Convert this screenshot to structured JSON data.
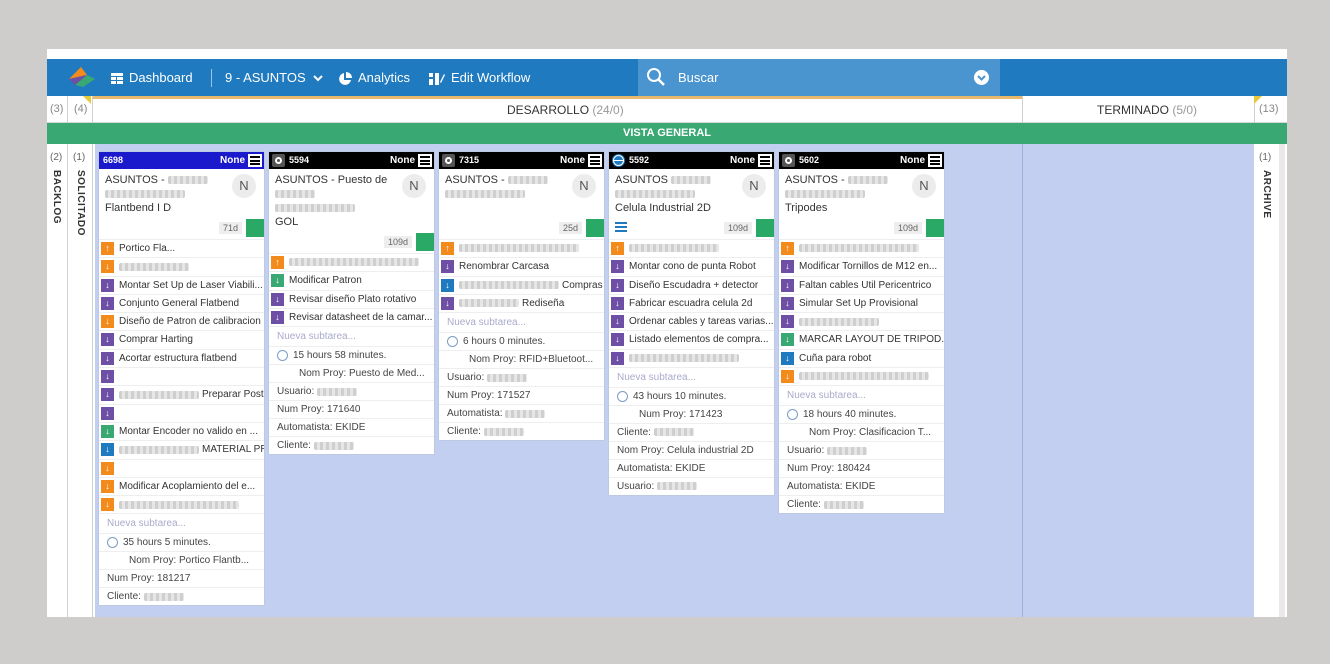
{
  "topbar": {
    "dashboard": "Dashboard",
    "board_select": "9 - ASUNTOS",
    "analytics": "Analytics",
    "edit_workflow": "Edit Workflow",
    "search_label": "Buscar"
  },
  "header": {
    "left_count_1": "(3)",
    "left_count_2": "(4)",
    "desarrollo_title": "DESARROLLO",
    "desarrollo_count": "(24/0)",
    "terminado_title": "TERMINADO",
    "terminado_count": "(5/0)",
    "right_count": "(13)"
  },
  "vista_general": "VISTA GENERAL",
  "side": {
    "backlog_count": "(2)",
    "backlog": "BACKLOG",
    "solicitado_count": "(1)",
    "solicitado": "SOLICITADO",
    "archive_count": "(1)",
    "archive": "ARCHIVE"
  },
  "colors": {
    "topbar": "#1f7abf",
    "search": "#4a94d0",
    "vista": "#3aa873",
    "lane": "#c2cff0",
    "orange": "#f28a1c",
    "purple": "#6e4fa6",
    "green": "#3aa873",
    "blue": "#1f7abf"
  },
  "cards": [
    {
      "id": "6698",
      "none": "None",
      "avatar": "N",
      "title_1": "ASUNTOS -",
      "title_2": "Flantbend I D",
      "age": "71d",
      "subtasks": [
        {
          "c": "o",
          "t": "Portico Fla..."
        },
        {
          "c": "o",
          "t": ""
        },
        {
          "c": "p",
          "t": "Montar Set Up de Laser Viabili..."
        },
        {
          "c": "p",
          "t": "Conjunto General Flatbend"
        },
        {
          "c": "o",
          "t": "Diseño de Patron de calibracion"
        },
        {
          "c": "p",
          "t": "Comprar Harting"
        },
        {
          "c": "p",
          "t": "Acortar estructura flatbend"
        },
        {
          "c": "p",
          "t": ""
        },
        {
          "c": "p",
          "t": "Preparar Poste"
        },
        {
          "c": "p",
          "t": ""
        },
        {
          "c": "g",
          "t": "Montar Encoder no valido en ..."
        },
        {
          "c": "bl",
          "t": "MATERIAL PRESTAMO"
        },
        {
          "c": "o",
          "t": ""
        },
        {
          "c": "o",
          "t": "Modificar Acoplamiento del e..."
        },
        {
          "c": "o",
          "t": ""
        }
      ],
      "nueva": "Nueva subtarea...",
      "hours": "35 hours 5 minutes.",
      "nom_proy": "Nom Proy: Portico Flantb...",
      "extra": [
        "Num Proy: 181217",
        "Cliente:"
      ]
    },
    {
      "id": "5594",
      "none": "None",
      "avatar": "N",
      "title_1": "ASUNTOS - Puesto de",
      "title_2": "GOL",
      "age": "109d",
      "subtasks": [
        {
          "c": "o",
          "t": ""
        },
        {
          "c": "g",
          "t": "Modificar Patron"
        },
        {
          "c": "p",
          "t": "Revisar diseño Plato rotativo"
        },
        {
          "c": "p",
          "t": "Revisar datasheet de la camar..."
        }
      ],
      "nueva": "Nueva subtarea...",
      "hours": "15 hours 58 minutes.",
      "nom_proy": "Nom Proy: Puesto de Med...",
      "extra": [
        "Usuario:",
        "Num Proy: 171640",
        "Automatista: EKIDE",
        "Cliente:"
      ]
    },
    {
      "id": "7315",
      "none": "None",
      "avatar": "N",
      "title_1": "ASUNTOS -",
      "title_2": "",
      "age": "25d",
      "subtasks": [
        {
          "c": "o",
          "t": ""
        },
        {
          "c": "p",
          "t": "Renombrar Carcasa"
        },
        {
          "c": "bl",
          "t": "Compras carcasa"
        },
        {
          "c": "p",
          "t": "Rediseña"
        }
      ],
      "nueva": "Nueva subtarea...",
      "hours": "6 hours 0 minutes.",
      "nom_proy": "Nom Proy: RFID+Bluetoot...",
      "extra": [
        "Usuario:",
        "Num Proy: 171527",
        "Automatista:",
        "Cliente:"
      ]
    },
    {
      "id": "5592",
      "none": "None",
      "avatar": "N",
      "title_1": "ASUNTOS",
      "title_2": "Celula Industrial 2D",
      "age": "109d",
      "subtasks": [
        {
          "c": "o",
          "t": ""
        },
        {
          "c": "p",
          "t": "Montar cono de punta Robot"
        },
        {
          "c": "p",
          "t": "Diseño Escudadra + detector"
        },
        {
          "c": "p",
          "t": "Fabricar escuadra celula 2d"
        },
        {
          "c": "p",
          "t": "Ordenar cables y tareas varias..."
        },
        {
          "c": "p",
          "t": "Listado elementos de compra..."
        },
        {
          "c": "p",
          "t": ""
        }
      ],
      "nueva": "Nueva subtarea...",
      "hours": "43 hours 10 minutes.",
      "nom_proy": "Num Proy: 171423",
      "extra": [
        "Cliente:",
        "Nom Proy: Celula industrial 2D",
        "Automatista: EKIDE",
        "Usuario:"
      ]
    },
    {
      "id": "5602",
      "none": "None",
      "avatar": "N",
      "title_1": "ASUNTOS -",
      "title_2": "Tripodes",
      "age": "109d",
      "subtasks": [
        {
          "c": "o",
          "t": ""
        },
        {
          "c": "p",
          "t": "Modificar Tornillos de M12 en..."
        },
        {
          "c": "p",
          "t": "Faltan cables Util Pericentrico"
        },
        {
          "c": "p",
          "t": "Simular Set Up Provisional"
        },
        {
          "c": "p",
          "t": ""
        },
        {
          "c": "g",
          "t": "MARCAR LAYOUT DE TRIPOD..."
        },
        {
          "c": "bl",
          "t": "Cuña para robot"
        },
        {
          "c": "o",
          "t": ""
        }
      ],
      "nueva": "Nueva subtarea...",
      "hours": "18 hours 40 minutes.",
      "nom_proy": "Nom Proy: Clasificacion T...",
      "extra": [
        "Usuario:",
        "Num Proy: 180424",
        "Automatista: EKIDE",
        "Cliente:"
      ]
    }
  ]
}
